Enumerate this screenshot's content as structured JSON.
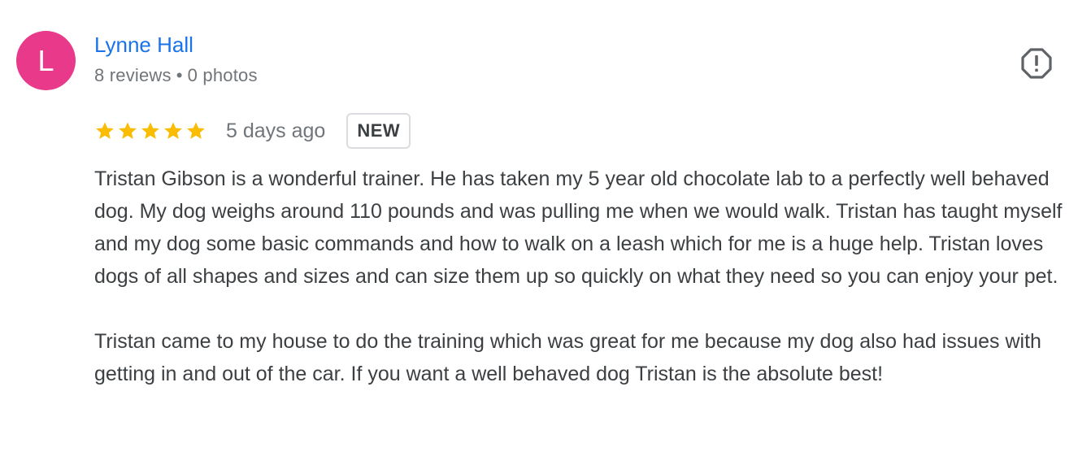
{
  "author": {
    "initial": "L",
    "name": "Lynne Hall",
    "reviews": "8 reviews",
    "separator": "•",
    "photos": "0 photos",
    "avatar_color": "#e8398a",
    "name_color": "#1a73e8"
  },
  "report": {
    "icon": "report-flag-icon"
  },
  "rating": {
    "stars": 5,
    "max_stars": 5,
    "star_color": "#fbbc04",
    "star_icon": "star-icon",
    "timestamp": "5 days ago",
    "badge": "NEW"
  },
  "review": {
    "paragraphs": [
      "Tristan Gibson is a wonderful trainer. He has taken my 5 year old chocolate lab to a perfectly well behaved dog. My dog weighs around 110 pounds and was pulling me when we would walk. Tristan has taught myself and my dog some basic commands and how to walk on a leash which for me is a huge help. Tristan loves dogs of all shapes and sizes and can size them up so quickly on what they need so you can enjoy your pet.",
      "Tristan came to my house to do the training which was great for me because my dog also had issues with getting in and out of the car. If you want a well behaved dog Tristan is the absolute best!"
    ]
  }
}
